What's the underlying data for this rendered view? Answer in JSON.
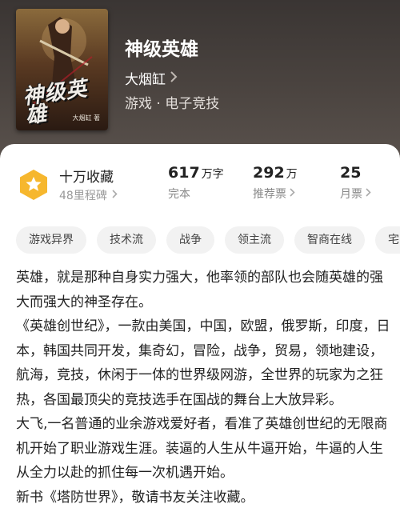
{
  "book": {
    "title": "神级英雄",
    "author": "大烟缸",
    "genre": "游戏 · 电子竞技",
    "cover_title": "神级英雄",
    "cover_author": "大烟缸 著"
  },
  "stats": {
    "favorites_label": "十万收藏",
    "milestone_label": "48里程碑",
    "words": {
      "value": "617",
      "unit": "万字",
      "label": "完本"
    },
    "recommend": {
      "value": "292",
      "unit": "万",
      "label": "推荐票"
    },
    "monthly": {
      "value": "25",
      "unit": "",
      "label": "月票"
    }
  },
  "tags": [
    "游戏异界",
    "技术流",
    "战争",
    "领主流",
    "智商在线",
    "宅"
  ],
  "description": [
    "英雄，就是那种自身实力强大，他率领的部队也会随英雄的强大而强大的神圣存在。",
    "《英雄创世纪》，一款由美国，中国，欧盟，俄罗斯，印度，日本，韩国共同开发，集奇幻，冒险，战争，贸易，领地建设，航海，竞技，休闲于一体的世界级网游，全世界的玩家为之狂热，各国最顶尖的竞技选手在国战的舞台上大放异彩。",
    "大飞,一名普通的业余游戏爱好者，看准了英雄创世纪的无限商机开始了职业游戏生涯。装逼的人生从牛逼开始，牛逼的人生从全力以赴的抓住每一次机遇开始。",
    "新书《塔防世界》，敬请书友关注收藏。"
  ],
  "colors": {
    "header_bg": "#4b4440",
    "badge_yellow": "#f6b72e",
    "tag_bg": "#f2f2f2"
  },
  "icons": {
    "favorites_badge": "star-hexagon-icon",
    "chevron": "chevron-right-icon"
  }
}
